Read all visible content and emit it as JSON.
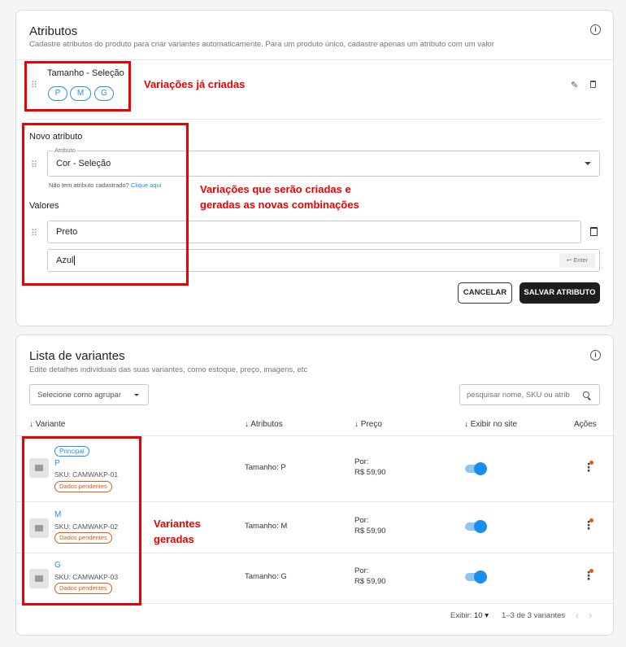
{
  "attributes": {
    "title": "Atributos",
    "subtitle": "Cadastre atributos do produto para criar variantes automaticamente. Para um produto único, cadastre apenas um atributo com um valor",
    "existing": {
      "name": "Tamanho - Seleção",
      "values": [
        "P",
        "M",
        "G"
      ]
    },
    "new_attribute": {
      "heading": "Novo atributo",
      "field_label": "Atributo",
      "field_value": "Cor - Seleção",
      "hint": "Não tem atributo cadastrado?",
      "hint_link": "Clique aqui",
      "values_heading": "Valores",
      "values": [
        "Preto",
        "Azul"
      ],
      "enter_hint": "Enter"
    },
    "buttons": {
      "cancel": "CANCELAR",
      "save": "SALVAR ATRIBUTO"
    }
  },
  "annotations": {
    "created": "Variações já criadas",
    "to_create_line1": "Variações que serão criadas e",
    "to_create_line2": "geradas as novas combinações",
    "generated_line1": "Variantes",
    "generated_line2": "geradas"
  },
  "variants": {
    "title": "Lista de variantes",
    "subtitle": "Edite detalhes individuais das suas variantes, como estoque, preço, imagens, etc",
    "group_select": "Selecione como agrupar",
    "search_placeholder": "pesquisar nome, SKU ou atrib",
    "columns": {
      "variant": "Variante",
      "attributes": "Atributos",
      "price": "Preço",
      "show": "Exibir no site",
      "actions": "Ações"
    },
    "badge_principal": "Principal",
    "rows": [
      {
        "name": "P",
        "sku": "SKU: CAMWAKP-01",
        "status": "Dados pendentes",
        "attr": "Tamanho: P",
        "price_label": "Por:",
        "price": "R$ 59,90",
        "visible": true
      },
      {
        "name": "M",
        "sku": "SKU: CAMWAKP-02",
        "status": "Dados pendentes",
        "attr": "Tamanho: M",
        "price_label": "Por:",
        "price": "R$ 59,90",
        "visible": true
      },
      {
        "name": "G",
        "sku": "SKU: CAMWAKP-03",
        "status": "Dados pendentes",
        "attr": "Tamanho: G",
        "price_label": "Por:",
        "price": "R$ 59,90",
        "visible": true
      }
    ],
    "pagination": {
      "show_label": "Exibir:",
      "page_size": "10",
      "range": "1–3 de 3 variantes"
    }
  },
  "colors": {
    "accent": "#2a8ee0",
    "annotation_red": "#e00000",
    "pending_orange": "#e05a1a",
    "dark_button": "#1e1e1e"
  }
}
